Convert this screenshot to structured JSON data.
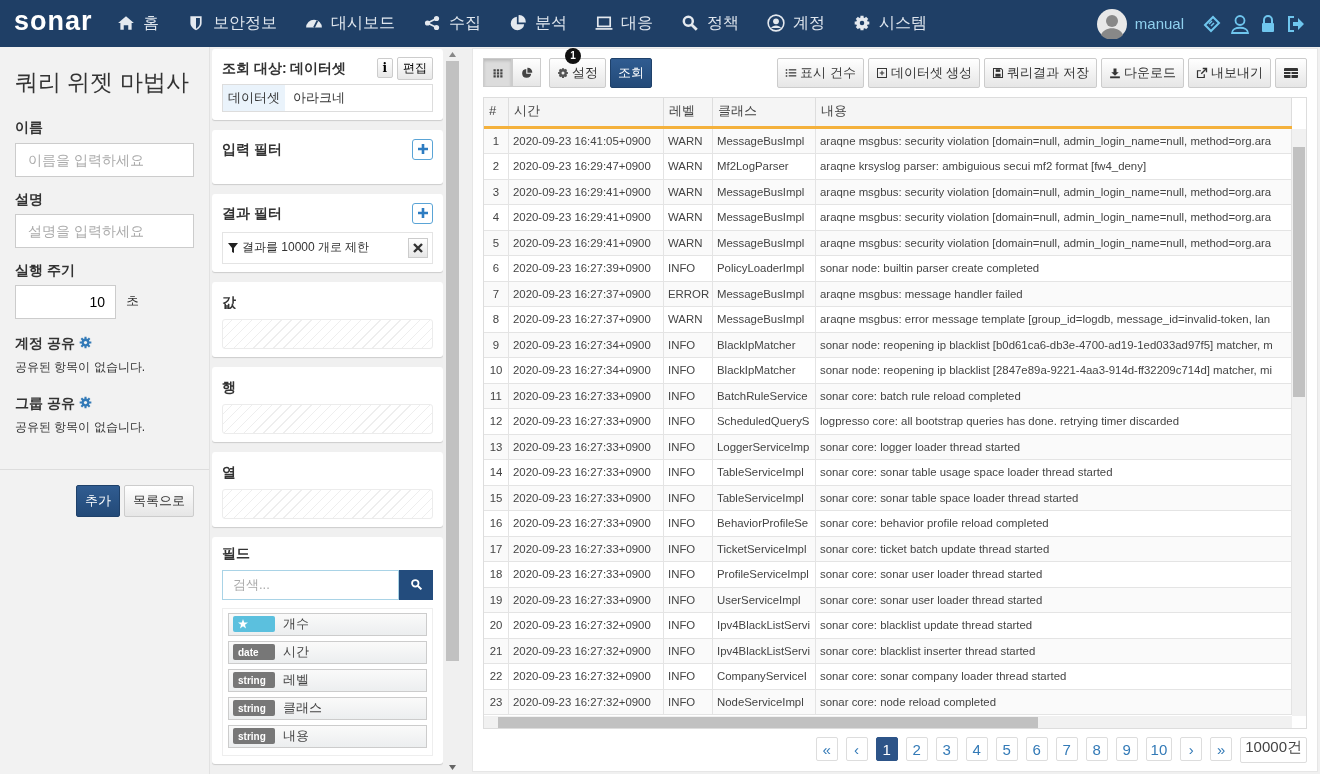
{
  "nav": {
    "logo": "sonar",
    "items": [
      {
        "label": "홈"
      },
      {
        "label": "보안정보"
      },
      {
        "label": "대시보드"
      },
      {
        "label": "수집"
      },
      {
        "label": "분석"
      },
      {
        "label": "대응"
      },
      {
        "label": "정책"
      },
      {
        "label": "계정"
      },
      {
        "label": "시스템"
      }
    ],
    "user": "manual"
  },
  "wizard": {
    "title": "쿼리 위젯 마법사",
    "fields": [
      {
        "label": "이름",
        "placeholder": "이름을 입력하세요"
      },
      {
        "label": "설명",
        "placeholder": "설명을 입력하세요"
      }
    ],
    "period": {
      "label": "실행 주기",
      "value": "10",
      "unit": "초"
    },
    "shares": [
      {
        "label": "계정 공유",
        "empty": "공유된 항목이 없습니다."
      },
      {
        "label": "그룹 공유",
        "empty": "공유된 항목이 없습니다."
      }
    ],
    "buttons": [
      {
        "label": "추가",
        "kind": "primary"
      },
      {
        "label": "목록으로",
        "kind": "default"
      }
    ]
  },
  "target": {
    "title": "조회 대상: 데이터셋",
    "info": "i",
    "edit": "편집",
    "tag": "데이터셋",
    "value": "아라크네"
  },
  "input_filter": {
    "title": "입력 필터"
  },
  "result_filter": {
    "title": "결과 필터",
    "items": [
      "결과를 10000 개로 제한"
    ]
  },
  "drop_zones": [
    {
      "title": "값"
    },
    {
      "title": "행"
    },
    {
      "title": "열"
    }
  ],
  "fields_panel": {
    "title": "필드",
    "placeholder": "검색...",
    "items": [
      {
        "kind": "count",
        "name": "개수"
      },
      {
        "kind": "typed",
        "type": "date",
        "name": "시간"
      },
      {
        "kind": "typed",
        "type": "string",
        "name": "레벨"
      },
      {
        "kind": "typed",
        "type": "string",
        "name": "클래스"
      },
      {
        "kind": "typed",
        "type": "string",
        "name": "내용"
      }
    ]
  },
  "toolbar": {
    "views": [
      {
        "selected": true
      },
      {
        "selected": false
      }
    ],
    "settings": {
      "label": "설정",
      "badge": "1"
    },
    "run": "조회",
    "actions": [
      "표시 건수",
      "데이터셋 생성",
      "쿼리결과 저장",
      "다운로드",
      "내보내기"
    ]
  },
  "table": {
    "columns": [
      "#",
      "시간",
      "레벨",
      "클래스",
      "내용"
    ],
    "rows": [
      [
        "1",
        "2020-09-23 16:41:05+0900",
        "WARN",
        "MessageBusImpl",
        "araqne msgbus: security violation [domain=null, admin_login_name=null, method=org.ara"
      ],
      [
        "2",
        "2020-09-23 16:29:47+0900",
        "WARN",
        "Mf2LogParser",
        "araqne krsyslog parser: ambiguious secui mf2 format [fw4_deny]"
      ],
      [
        "3",
        "2020-09-23 16:29:41+0900",
        "WARN",
        "MessageBusImpl",
        "araqne msgbus: security violation [domain=null, admin_login_name=null, method=org.ara"
      ],
      [
        "4",
        "2020-09-23 16:29:41+0900",
        "WARN",
        "MessageBusImpl",
        "araqne msgbus: security violation [domain=null, admin_login_name=null, method=org.ara"
      ],
      [
        "5",
        "2020-09-23 16:29:41+0900",
        "WARN",
        "MessageBusImpl",
        "araqne msgbus: security violation [domain=null, admin_login_name=null, method=org.ara"
      ],
      [
        "6",
        "2020-09-23 16:27:39+0900",
        "INFO",
        "PolicyLoaderImpl",
        "sonar node: builtin parser create completed"
      ],
      [
        "7",
        "2020-09-23 16:27:37+0900",
        "ERROR",
        "MessageBusImpl",
        "araqne msgbus: message handler failed"
      ],
      [
        "8",
        "2020-09-23 16:27:37+0900",
        "WARN",
        "MessageBusImpl",
        "araqne msgbus: error message template [group_id=logdb, message_id=invalid-token, lan"
      ],
      [
        "9",
        "2020-09-23 16:27:34+0900",
        "INFO",
        "BlackIpMatcher",
        "sonar node: reopening ip blacklist [b0d61ca6-db3e-4700-ad19-1ed033ad97f5] matcher, m"
      ],
      [
        "10",
        "2020-09-23 16:27:34+0900",
        "INFO",
        "BlackIpMatcher",
        "sonar node: reopening ip blacklist [2847e89a-9221-4aa3-914d-ff32209c714d] matcher, mi"
      ],
      [
        "11",
        "2020-09-23 16:27:33+0900",
        "INFO",
        "BatchRuleService",
        "sonar core: batch rule reload completed"
      ],
      [
        "12",
        "2020-09-23 16:27:33+0900",
        "INFO",
        "ScheduledQueryS",
        "logpresso core: all bootstrap queries has done. retrying timer discarded"
      ],
      [
        "13",
        "2020-09-23 16:27:33+0900",
        "INFO",
        "LoggerServiceImp",
        "sonar core: logger loader thread started"
      ],
      [
        "14",
        "2020-09-23 16:27:33+0900",
        "INFO",
        "TableServiceImpl",
        "sonar core: sonar table usage space loader thread started"
      ],
      [
        "15",
        "2020-09-23 16:27:33+0900",
        "INFO",
        "TableServiceImpl",
        "sonar core: sonar table space loader thread started"
      ],
      [
        "16",
        "2020-09-23 16:27:33+0900",
        "INFO",
        "BehaviorProfileSe",
        "sonar core: behavior profile reload completed"
      ],
      [
        "17",
        "2020-09-23 16:27:33+0900",
        "INFO",
        "TicketServiceImpl",
        "sonar core: ticket batch update thread started"
      ],
      [
        "18",
        "2020-09-23 16:27:33+0900",
        "INFO",
        "ProfileServiceImpl",
        "sonar core: sonar user loader thread started"
      ],
      [
        "19",
        "2020-09-23 16:27:33+0900",
        "INFO",
        "UserServiceImpl",
        "sonar core: sonar user loader thread started"
      ],
      [
        "20",
        "2020-09-23 16:27:32+0900",
        "INFO",
        "Ipv4BlackListServi",
        "sonar core: blacklist update thread started"
      ],
      [
        "21",
        "2020-09-23 16:27:32+0900",
        "INFO",
        "Ipv4BlackListServi",
        "sonar core: blacklist inserter thread started"
      ],
      [
        "22",
        "2020-09-23 16:27:32+0900",
        "INFO",
        "CompanyServiceI",
        "sonar core: sonar company loader thread started"
      ],
      [
        "23",
        "2020-09-23 16:27:32+0900",
        "INFO",
        "NodeServiceImpl",
        "sonar core: node reload completed"
      ]
    ]
  },
  "pagination": {
    "first": "«",
    "prev": "‹",
    "pages": [
      {
        "label": "1",
        "selected": true
      },
      {
        "label": "2",
        "selected": false
      },
      {
        "label": "3",
        "selected": false
      },
      {
        "label": "4",
        "selected": false
      },
      {
        "label": "5",
        "selected": false
      },
      {
        "label": "6",
        "selected": false
      },
      {
        "label": "7",
        "selected": false
      },
      {
        "label": "8",
        "selected": false
      },
      {
        "label": "9",
        "selected": false
      },
      {
        "label": "10",
        "selected": false
      }
    ],
    "next": "›",
    "last": "»",
    "total": "10000건"
  }
}
